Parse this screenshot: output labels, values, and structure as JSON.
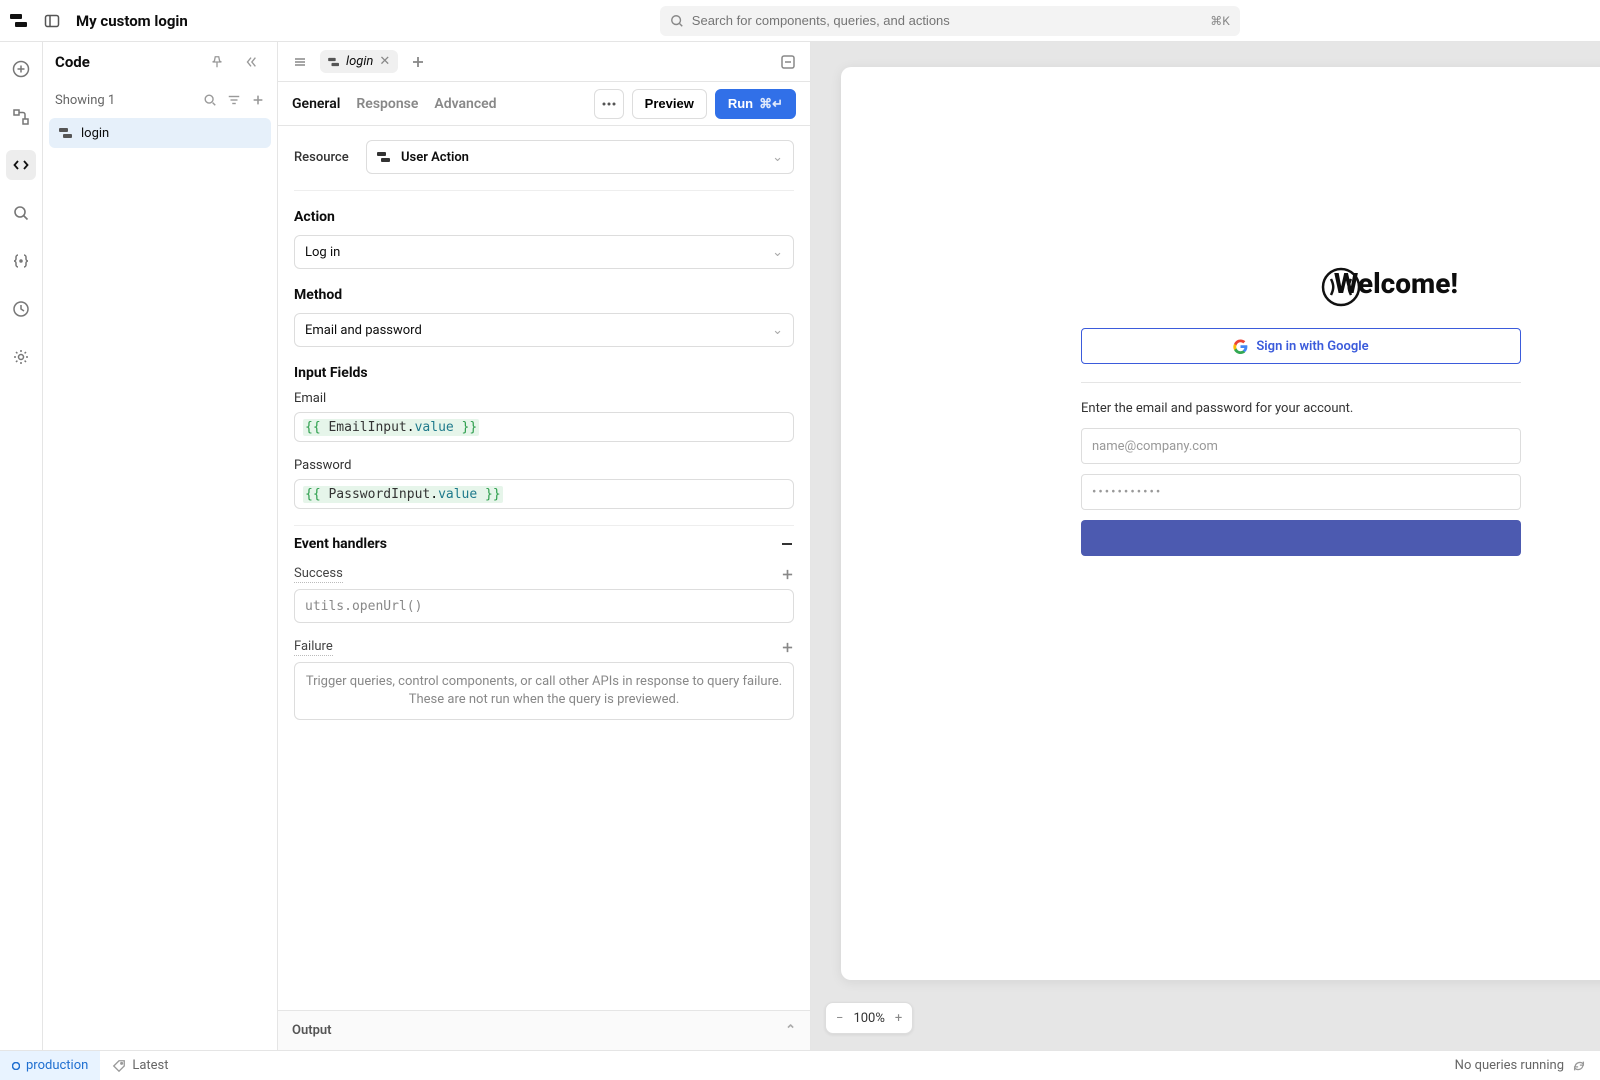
{
  "header": {
    "title": "My custom login",
    "search_placeholder": "Search for components, queries, and actions",
    "search_kbd": "⌘K"
  },
  "codePanel": {
    "title": "Code",
    "showing": "Showing 1",
    "items": [
      {
        "label": "login"
      }
    ]
  },
  "editor": {
    "tabLabel": "login",
    "subtabs": {
      "general": "General",
      "response": "Response",
      "advanced": "Advanced"
    },
    "preview_btn": "Preview",
    "run_btn": "Run",
    "run_kbd": "⌘↵",
    "resource_label": "Resource",
    "resource_value": "User Action",
    "action_label": "Action",
    "action_value": "Log in",
    "method_label": "Method",
    "method_value": "Email and password",
    "input_fields_label": "Input Fields",
    "email_label": "Email",
    "email_expr_open": "{{ ",
    "email_ident": "EmailInput",
    "email_dot": ".",
    "email_prop": "value",
    "email_expr_close": " }}",
    "password_label": "Password",
    "password_ident": "PasswordInput",
    "event_handlers_label": "Event handlers",
    "success_label": "Success",
    "success_expr": "utils.openUrl()",
    "failure_label": "Failure",
    "failure_placeholder": "Trigger queries, control components, or call other APIs in response to query failure. These are not run when the query is previewed.",
    "output_label": "Output"
  },
  "preview": {
    "welcome": "Welcome!",
    "google_btn": "Sign in with Google",
    "hint": "Enter the email and password for your account.",
    "email_placeholder": "name@company.com",
    "password_dots": "•••••••••••",
    "zoom": "100%"
  },
  "statusbar": {
    "env": "production",
    "latest": "Latest",
    "queries": "No queries running"
  }
}
